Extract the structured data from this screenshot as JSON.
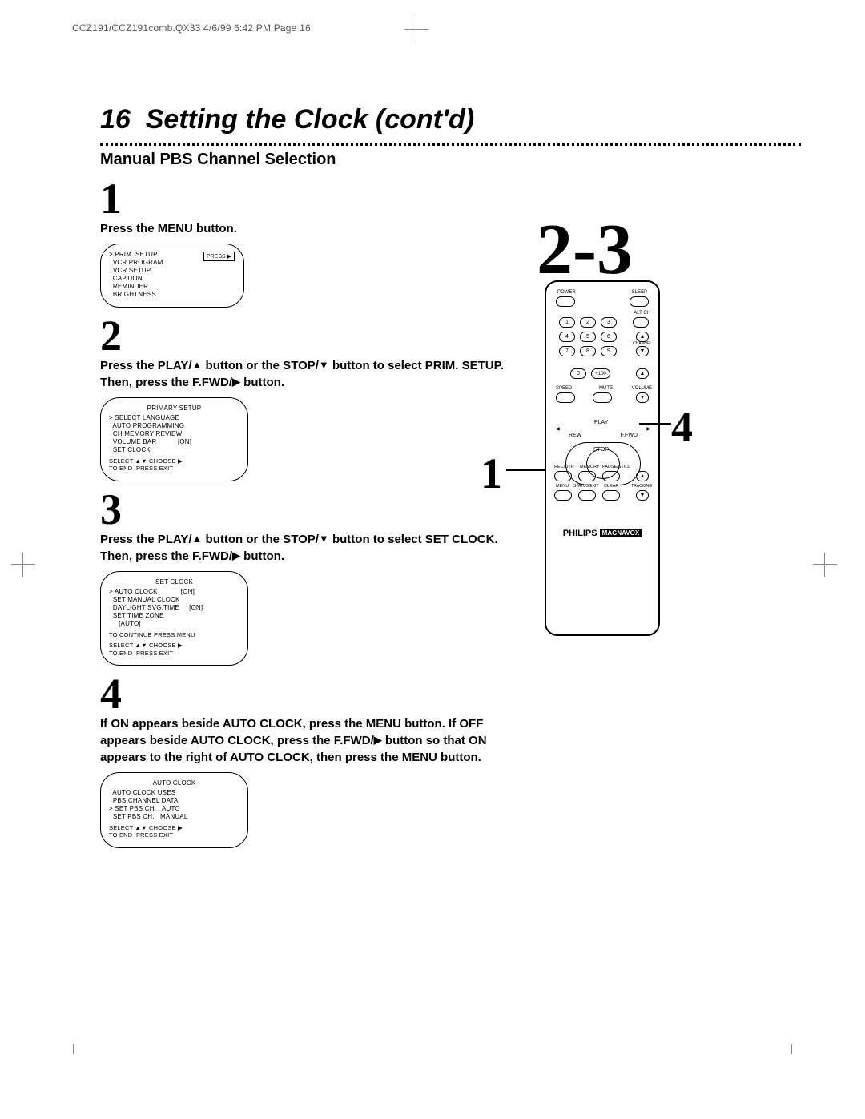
{
  "header": {
    "crop_text": "CCZ191/CCZ191comb.QX33  4/6/99 6:42 PM  Page 16"
  },
  "page": {
    "number": "16",
    "title": "Setting the Clock (cont'd)",
    "section": "Manual PBS Channel Selection"
  },
  "steps": {
    "s1": {
      "num": "1",
      "text": "Press the MENU button."
    },
    "s2": {
      "num": "2",
      "text_a": "Press the PLAY/",
      "text_b": " button or the STOP/",
      "text_c": " button to select PRIM. SETUP.  Then, press the F.FWD/",
      "text_d": " button."
    },
    "s3": {
      "num": "3",
      "text_a": "Press the PLAY/",
      "text_b": " button or the STOP/",
      "text_c": " button to select SET CLOCK. Then, press the F.FWD/",
      "text_d": " button."
    },
    "s4": {
      "num": "4",
      "text_a": "If ON appears beside AUTO CLOCK, press the MENU button. If OFF appears beside AUTO CLOCK, press the F.FWD/",
      "text_b": " button so that ON appears to the right of AUTO CLOCK, then press the MENU button."
    }
  },
  "menubox1": {
    "press": "PRESS ▶",
    "rows": [
      "> PRIM. SETUP",
      "  VCR PROGRAM",
      "  VCR SETUP",
      "  CAPTION",
      "  REMINDER",
      "  BRIGHTNESS"
    ]
  },
  "menubox2": {
    "title": "PRIMARY SETUP",
    "rows": [
      "> SELECT LANGUAGE",
      "  AUTO PROGRAMMING",
      "  CH MEMORY REVIEW",
      "  VOLUME BAR           [ON]",
      "  SET CLOCK"
    ],
    "footer": "SELECT ▲▼ CHOOSE ▶\nTO END  PRESS EXIT"
  },
  "menubox3": {
    "title": "SET CLOCK",
    "rows": [
      "> AUTO CLOCK            [ON]",
      "  SET MANUAL CLOCK",
      "  DAYLIGHT SVG.TIME     [ON]",
      "  SET TIME ZONE",
      "     [AUTO]"
    ],
    "mid": "TO CONTINUE PRESS MENU",
    "footer": "SELECT ▲▼ CHOOSE ▶\nTO END  PRESS EXIT"
  },
  "menubox4": {
    "title": "AUTO CLOCK",
    "rows": [
      "  AUTO CLOCK USES",
      "  PBS CHANNEL DATA",
      "",
      "> SET PBS CH.   AUTO",
      "  SET PBS CH.   MANUAL"
    ],
    "footer": "SELECT ▲▼ CHOOSE ▶\nTO END  PRESS EXIT"
  },
  "remote": {
    "big": "2-3",
    "callouts": {
      "left": "1",
      "right": "4"
    },
    "labels": {
      "power": "POWER",
      "sleep": "SLEEP",
      "altch": "ALT CH",
      "channel": "CHANNEL",
      "speed": "SPEED",
      "mute": "MUTE",
      "volume": "VOLUME",
      "play": "PLAY",
      "rew": "REW",
      "ffwd": "F.FWD",
      "stop": "STOP",
      "recotr": "REC/OTR",
      "memory": "MEMORY",
      "pausestill": "PAUSE/STILL",
      "menu": "MENU",
      "statusexit": "STATUS/EXIT",
      "clear": "CLEAR",
      "tracking": "TRACKING"
    },
    "nums": {
      "n1": "1",
      "n2": "2",
      "n3": "3",
      "n4": "4",
      "n5": "5",
      "n6": "6",
      "n7": "7",
      "n8": "8",
      "n9": "9",
      "n0": "0",
      "n100": "+100"
    },
    "brand_a": "PHILIPS",
    "brand_b": "MAGNAVOX"
  }
}
